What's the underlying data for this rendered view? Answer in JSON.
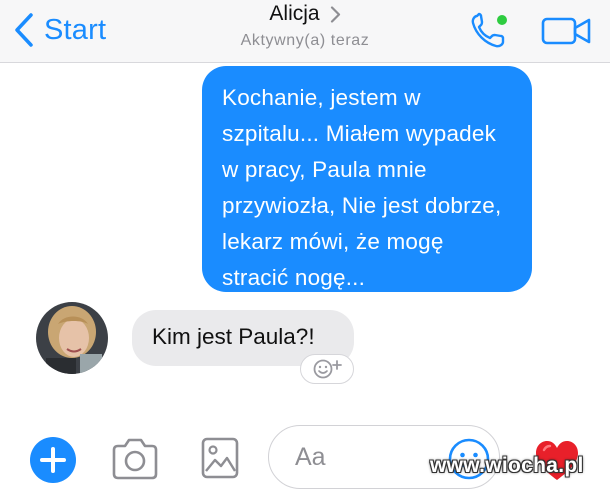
{
  "header": {
    "back_label": "Start",
    "contact_name": "Alicja",
    "status": "Aktywny(a) teraz"
  },
  "messages": [
    {
      "direction": "outgoing",
      "text": "Kochanie, jestem w szpitalu... Miałem wypadek w pracy, Paula mnie przywiozła, Nie jest dobrze, lekarz mówi, że mogę stracić nogę..."
    },
    {
      "direction": "incoming",
      "text": "Kim jest Paula?!"
    }
  ],
  "composer": {
    "placeholder": "Aa"
  },
  "watermark": "www.wiocha.pl",
  "icons": {
    "back": "chevron-left-icon",
    "contact_arrow": "chevron-right-icon",
    "call": "phone-icon",
    "video": "video-camera-icon",
    "plus": "plus-icon",
    "camera": "camera-icon",
    "gallery": "image-icon",
    "emoji": "smiley-icon",
    "like": "heart-icon",
    "react": "add-reaction-icon"
  },
  "colors": {
    "accent": "#1a8cff",
    "online_dot": "#2ecc40",
    "incoming_bubble": "#eaeaec",
    "heart": "#e8202a"
  }
}
